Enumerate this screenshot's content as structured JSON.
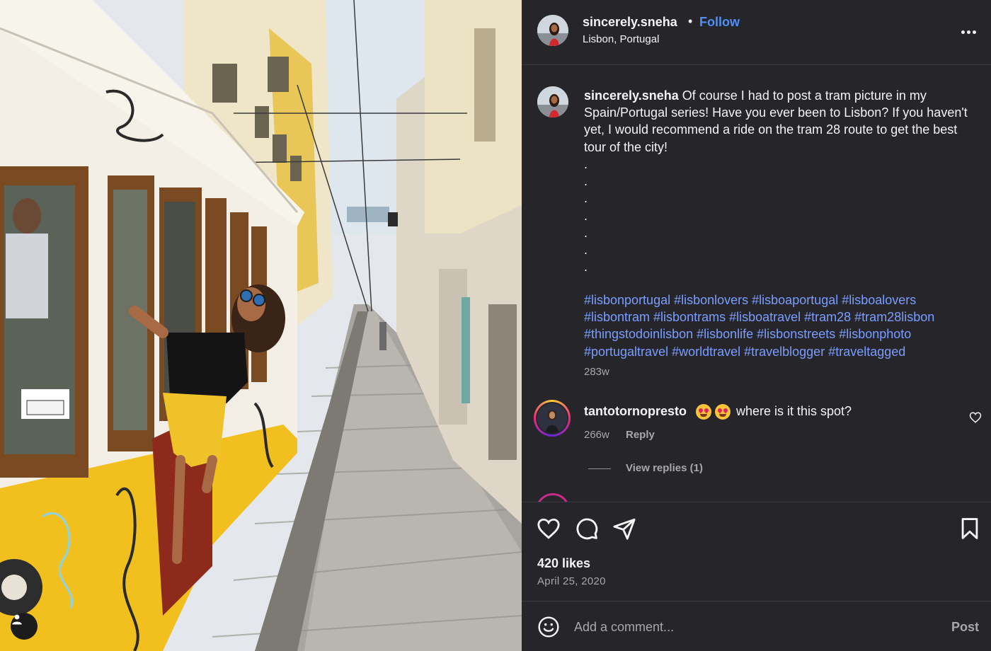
{
  "post": {
    "username": "sincerely.sneha",
    "separator": "•",
    "follow_label": "Follow",
    "location": "Lisbon, Portugal",
    "more_icon": "more-horizontal-icon"
  },
  "caption": {
    "username": "sincerely.sneha",
    "text": "Of course I had to post a tram picture in my Spain/Portugal series! Have you ever been to Lisbon? If you haven't yet, I would recommend a ride on the tram 28 route to get the best tour of the city!",
    "dots": [
      ".",
      ".",
      ".",
      ".",
      ".",
      ".",
      "."
    ],
    "hashtags": "#lisbonportugal #lisbonlovers #lisboaportugal #lisboalovers #lisbontram #lisbontrams #lisboatravel #tram28 #tram28lisbon #thingstodoinlisbon #lisbonlife #lisbonstreets #lisbonphoto #portugaltravel #worldtravel #travelblogger #traveltagged",
    "time": "283w"
  },
  "comments": [
    {
      "username": "tantotornopresto",
      "emoji": [
        "heart-eyes-emoji",
        "heart-eyes-emoji"
      ],
      "text": "where is it this spot?",
      "time": "266w",
      "reply_label": "Reply",
      "view_replies_label": "View replies (1)"
    }
  ],
  "actions": {
    "icons": [
      "heart-icon",
      "comment-icon",
      "share-icon",
      "bookmark-icon"
    ],
    "likes": "420 likes",
    "date": "April 25, 2020"
  },
  "add_comment": {
    "placeholder": "Add a comment...",
    "post_label": "Post"
  },
  "colors": {
    "panel_bg": "#25252a",
    "link_blue": "#4f8ff7",
    "hashtag_blue": "#7b9dff",
    "muted": "#a8a8a8",
    "tram_yellow": "#f2c01e"
  }
}
